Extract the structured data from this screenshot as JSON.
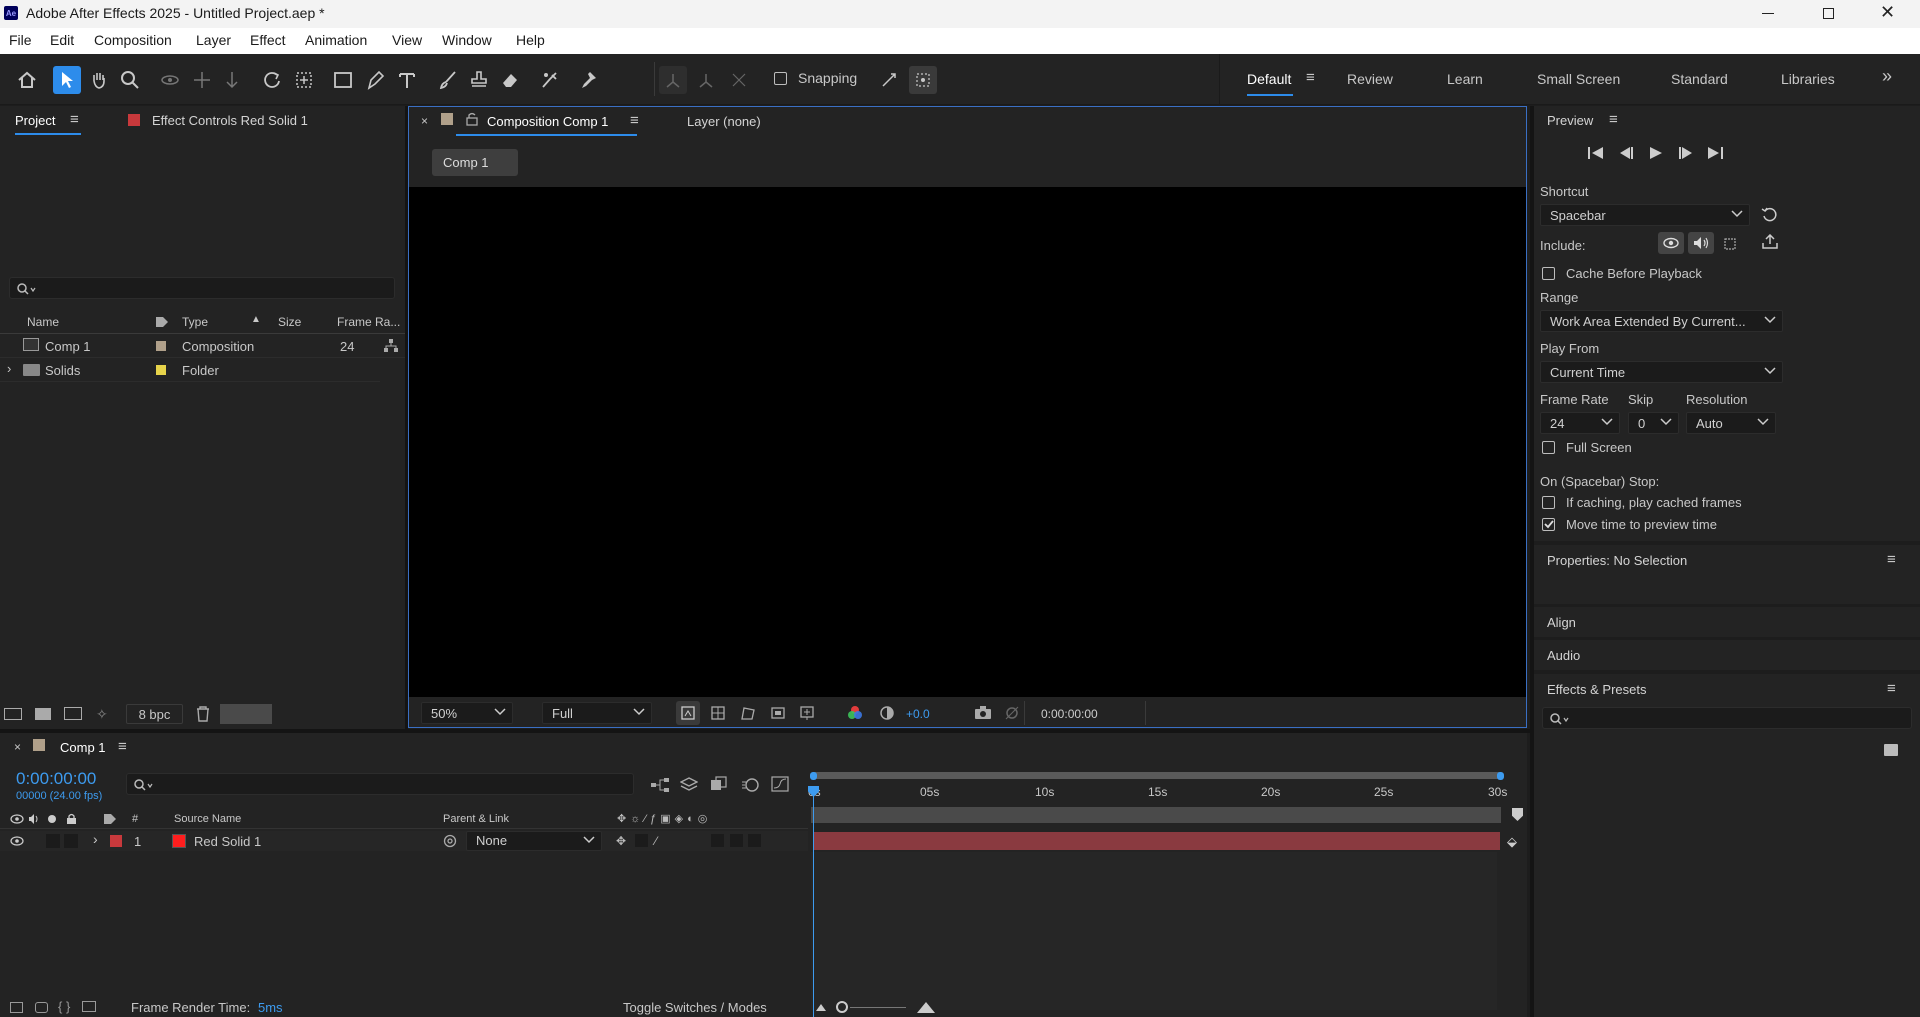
{
  "window": {
    "title": "Adobe After Effects 2025 - Untitled Project.aep *",
    "app_badge": "Ae"
  },
  "menu": [
    "File",
    "Edit",
    "Composition",
    "Layer",
    "Effect",
    "Animation",
    "View",
    "Window",
    "Help"
  ],
  "toolbar": {
    "snapping_label": "Snapping"
  },
  "workspaces": {
    "active": "Default",
    "items": [
      "Default",
      "Review",
      "Learn",
      "Small Screen",
      "Standard",
      "Libraries"
    ]
  },
  "project_panel": {
    "tab_project": "Project",
    "tab_effect_controls": "Effect Controls Red Solid 1",
    "columns": {
      "name": "Name",
      "type": "Type",
      "size": "Size",
      "frame_rate": "Frame Ra..."
    },
    "items": [
      {
        "name": "Comp 1",
        "type": "Composition",
        "frame_rate": "24",
        "label_color": "#b0a08a"
      },
      {
        "name": "Solids",
        "type": "Folder",
        "frame_rate": "",
        "label_color": "#e6d34a"
      }
    ],
    "bpc": "8 bpc"
  },
  "comp_viewer": {
    "tab_label": "Composition Comp 1",
    "layer_tab": "Layer (none)",
    "breadcrumb": "Comp 1",
    "zoom": "50%",
    "resolution": "Full",
    "exposure": "+0.0",
    "timecode": "0:00:00:00"
  },
  "preview_panel": {
    "title": "Preview",
    "shortcut_label": "Shortcut",
    "shortcut_value": "Spacebar",
    "include_label": "Include:",
    "cache_before": "Cache Before Playback",
    "range_label": "Range",
    "range_value": "Work Area Extended By Current...",
    "play_from_label": "Play From",
    "play_from_value": "Current Time",
    "frame_rate_label": "Frame Rate",
    "frame_rate_value": "24",
    "skip_label": "Skip",
    "skip_value": "0",
    "resolution_label": "Resolution",
    "resolution_value": "Auto",
    "full_screen": "Full Screen",
    "stop_label": "On (Spacebar) Stop:",
    "if_caching": "If caching, play cached frames",
    "move_time": "Move time to preview time",
    "move_time_checked": true
  },
  "properties": {
    "title": "Properties: No Selection"
  },
  "align": {
    "title": "Align"
  },
  "audio": {
    "title": "Audio"
  },
  "effects_presets": {
    "title": "Effects & Presets"
  },
  "timeline": {
    "tab_label": "Comp 1",
    "timecode": "0:00:00:00",
    "frames": "00000 (24.00 fps)",
    "columns": {
      "num": "#",
      "source": "Source Name",
      "parent": "Parent & Link"
    },
    "layers": [
      {
        "index": "1",
        "name": "Red Solid 1",
        "parent": "None",
        "color": "#ff1e1e"
      }
    ],
    "ruler": [
      "0s",
      "05s",
      "10s",
      "15s",
      "20s",
      "25s",
      "30s"
    ],
    "render_time_label": "Frame Render Time:",
    "render_time_value": "5ms",
    "toggle_label": "Toggle Switches / Modes"
  },
  "colors": {
    "accent": "#2d8ceb",
    "layer_bar": "#8a3a40",
    "timecode": "#3d9bef"
  }
}
